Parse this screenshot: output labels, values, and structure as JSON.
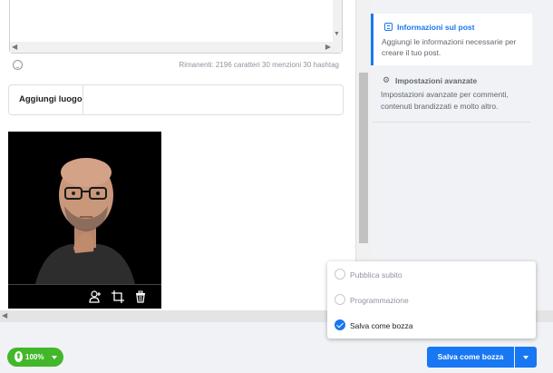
{
  "composer": {
    "counter_text": "Rimanenti: 2196 caratteri 30 menzioni 30 hashtag",
    "icons": {
      "emoji": "smile-icon"
    }
  },
  "place": {
    "label": "Aggiungi luogo",
    "placeholder": ""
  },
  "photo": {
    "tools": [
      "tag-person-icon",
      "crop-icon",
      "trash-icon"
    ]
  },
  "sidebar": {
    "sections": [
      {
        "title": "Informazioni sul post",
        "description": "Aggiungi le informazioni necessarie per creare il tuo post.",
        "icon": "document-icon",
        "active": true
      },
      {
        "title": "Impostazioni avanzate",
        "description": "Impostazioni avanzate per commenti, contenuti brandizzati e molto altro.",
        "icon": "gear-icon",
        "active": false
      }
    ]
  },
  "footer": {
    "zoom_value": "100%",
    "save_label": "Salva come bozza"
  },
  "publish_menu": {
    "options": [
      {
        "label": "Pubblica subito",
        "selected": false
      },
      {
        "label": "Programmazione",
        "selected": false
      },
      {
        "label": "Salva come bozza",
        "selected": true
      }
    ]
  },
  "colors": {
    "accent": "#1877f2",
    "zoom_green": "#42b72a",
    "muted_text": "#606770"
  }
}
